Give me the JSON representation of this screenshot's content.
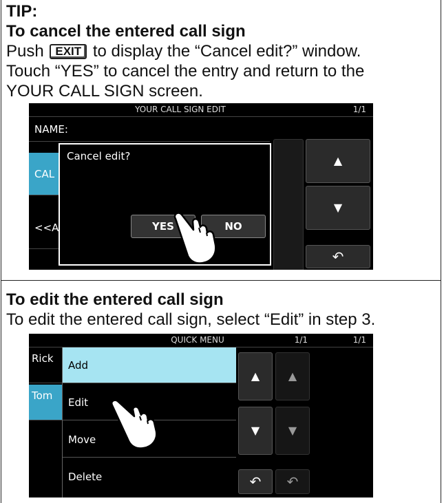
{
  "tip": {
    "heading": "TIP:",
    "section1_title": "To cancel the entered call sign",
    "push_word": "Push",
    "exit_key": "EXIT",
    "line1_rest": "to display the “Cancel edit?” window.",
    "line2": "Touch “YES” to cancel the entry and return to the",
    "line3": "YOUR CALL SIGN screen.",
    "section2_title": "To edit the entered call sign",
    "section2_body": "To edit the entered call sign, select “Edit” in step 3."
  },
  "screen1": {
    "title": "YOUR CALL SIGN EDIT",
    "page": "1/1",
    "rows": [
      "NAME:",
      "CAL",
      "<<A"
    ],
    "dialog_text": "Cancel edit?",
    "yes": "YES",
    "no": "NO",
    "up_icon": "triangle-up",
    "down_icon": "triangle-down",
    "back_icon": "return-arrow",
    "hand_icon": "pointing-hand"
  },
  "screen2": {
    "title": "QUICK MENU",
    "page": "1/1",
    "page_behind": "1/1",
    "left_rows": [
      "Rick",
      "Tom"
    ],
    "menu_items": [
      "Add",
      "Edit",
      "Move",
      "Delete"
    ],
    "highlight_color": "#a6e4f2",
    "accent_color": "#3aa5c8"
  }
}
